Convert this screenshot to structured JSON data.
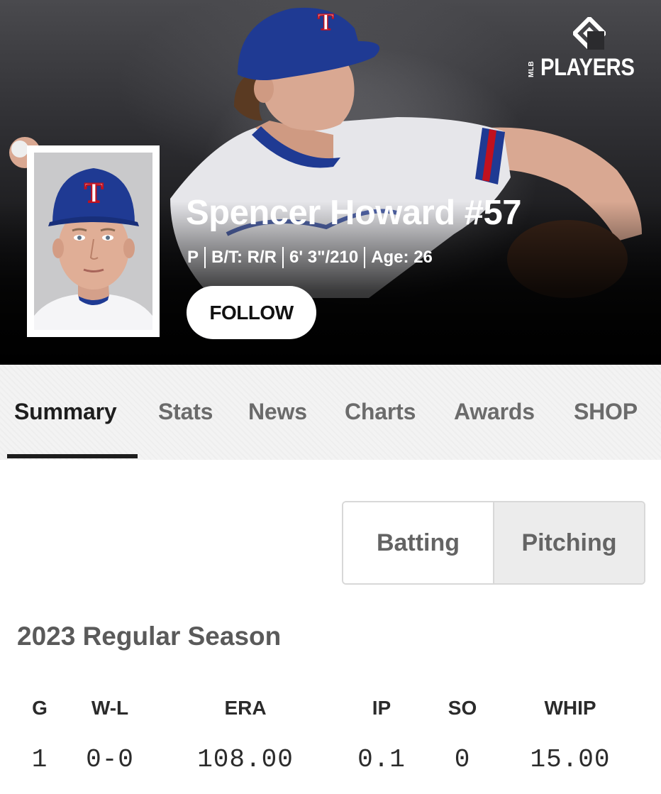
{
  "brand": {
    "logo_text": "PLAYERS",
    "logo_small_text": "MLB"
  },
  "player": {
    "name": "Spencer Howard #57",
    "position": "P",
    "bats_throws": "B/T: R/R",
    "height_weight": "6' 3\"/210",
    "age": "Age: 26",
    "cap_letter": "T",
    "follow_label": "FOLLOW"
  },
  "tabs": [
    {
      "label": "Summary",
      "active": true
    },
    {
      "label": "Stats",
      "active": false
    },
    {
      "label": "News",
      "active": false
    },
    {
      "label": "Charts",
      "active": false
    },
    {
      "label": "Awards",
      "active": false
    },
    {
      "label": "SHOP",
      "active": false
    }
  ],
  "toggle": {
    "batting_label": "Batting",
    "pitching_label": "Pitching",
    "selected": "Pitching"
  },
  "season": {
    "title": "2023 Regular Season",
    "columns": [
      "G",
      "W-L",
      "ERA",
      "IP",
      "SO",
      "WHIP"
    ],
    "values": [
      "1",
      "0-0",
      "108.00",
      "0.1",
      "0",
      "15.00"
    ]
  },
  "colors": {
    "team_blue": "#1f3a93",
    "team_red": "#c0111f",
    "active_tab": "#1e1e1e",
    "inactive_tab": "#6b6b6b"
  }
}
